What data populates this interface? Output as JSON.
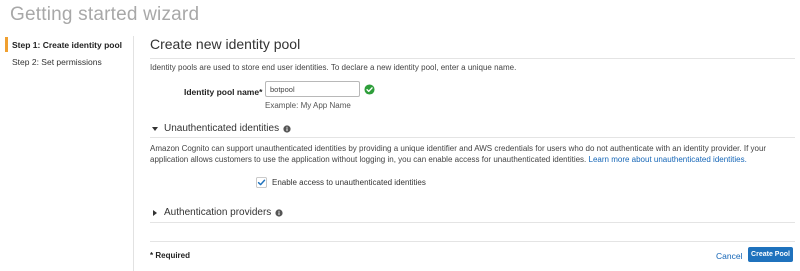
{
  "wizard": {
    "title": "Getting started wizard"
  },
  "sidebar": {
    "steps": [
      {
        "label": "Step 1: Create identity pool",
        "active": true
      },
      {
        "label": "Step 2: Set permissions",
        "active": false
      }
    ]
  },
  "main": {
    "title": "Create new identity pool",
    "intro": "Identity pools are used to store end user identities. To declare a new identity pool, enter a unique name.",
    "pool_name": {
      "label": "Identity pool name*",
      "value": "botpool",
      "example": "Example: My App Name",
      "valid_icon": "check-circle-icon"
    },
    "unauthenticated": {
      "title": "Unauthenticated identities",
      "expanded": true,
      "description": "Amazon Cognito can support unauthenticated identities by providing a unique identifier and AWS credentials for users who do not authenticate with an identity provider. If your application allows customers to use the application without logging in, you can enable access for unauthenticated identities.",
      "learn_more": "Learn more about unauthenticated identities.",
      "checkbox_label": "Enable access to unauthenticated identities",
      "checkbox_checked": true
    },
    "auth_providers": {
      "title": "Authentication providers",
      "expanded": false
    },
    "footer": {
      "required": "* Required",
      "cancel": "Cancel",
      "create": "Create Pool"
    }
  },
  "colors": {
    "accent_orange": "#f0a030",
    "link_blue": "#1566b7",
    "primary_button": "#1f72bd",
    "valid_green": "#2e9e3a"
  }
}
